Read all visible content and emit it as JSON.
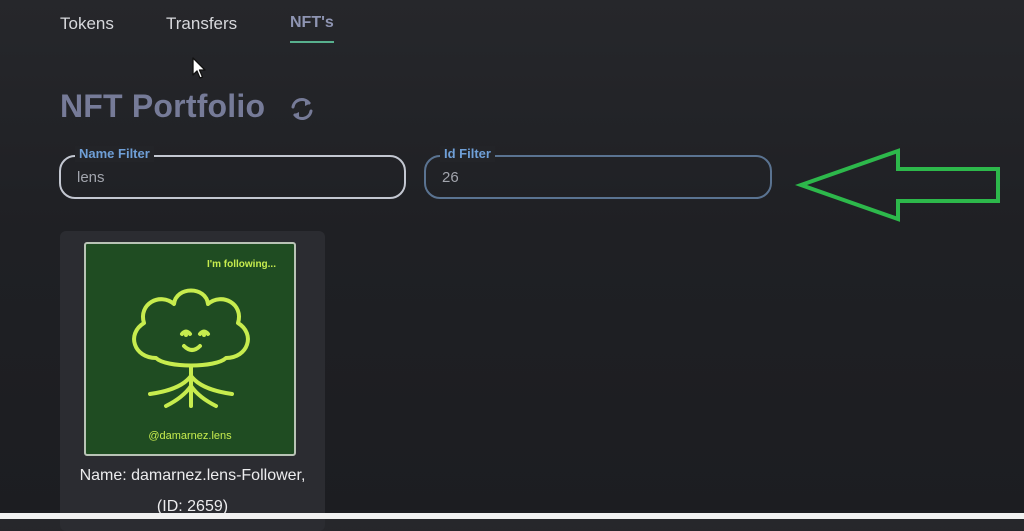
{
  "tabs": [
    {
      "label": "Tokens"
    },
    {
      "label": "Transfers"
    },
    {
      "label": "NFT's",
      "active": true
    }
  ],
  "portfolio": {
    "title": "NFT Portfolio",
    "refresh_icon": "refresh-icon"
  },
  "filters": {
    "name": {
      "label": "Name Filter",
      "value": "lens"
    },
    "id": {
      "label": "Id Filter",
      "value": "26"
    }
  },
  "nfts": [
    {
      "image_top_text": "I'm following...",
      "image_handle": "@damarnez.lens",
      "name_line": "Name: damarnez.lens-Follower,",
      "id_line": "(ID: 2659)"
    }
  ],
  "annotation": {
    "arrow_icon": "green-left-arrow",
    "color": "#2db84b"
  },
  "colors": {
    "background": "#1f2024",
    "accent_tab_underline": "#58b08e",
    "filter_label": "#6f9fd7",
    "nft_bg": "#1f4c22",
    "nft_lime": "#c7ec4e"
  }
}
